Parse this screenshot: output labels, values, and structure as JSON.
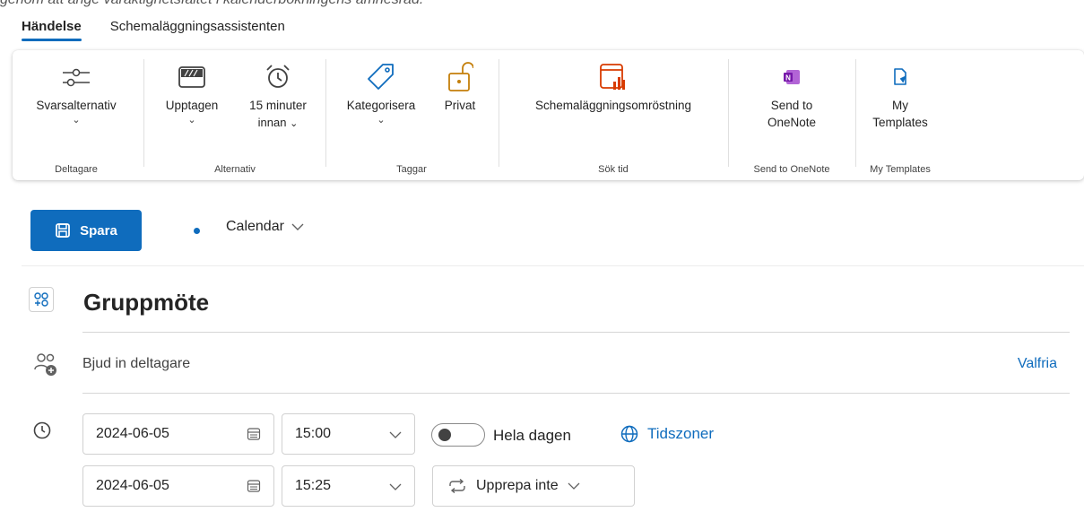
{
  "caption": "genom att ange varaktighetsfältet i kalenderbokningens ämnesrad.",
  "tabs": [
    {
      "label": "Händelse",
      "active": true
    },
    {
      "label": "Schemaläggningsassistenten",
      "active": false
    }
  ],
  "ribbon": {
    "groups": {
      "attendees": "Deltagare",
      "options": "Alternativ",
      "tags": "Taggar",
      "find_time": "Sök tid",
      "onenote": "Send to OneNote",
      "templates": "My Templates"
    },
    "buttons": {
      "response_options": "Svarsalternativ",
      "busy": "Upptagen",
      "reminder_line1": "15 minuter",
      "reminder_line2": "innan",
      "categorize": "Kategorisera",
      "private": "Privat",
      "poll": "Schemaläggningsomröstning",
      "send_onenote_line1": "Send to",
      "send_onenote_line2": "OneNote",
      "templates_line1": "My",
      "templates_line2": "Templates"
    },
    "colors": {
      "onenote": "#7719aa",
      "templates": "#0f6cbd",
      "poll": "#d83b01"
    }
  },
  "actions": {
    "save_label": "Spara",
    "calendar_label": "Calendar"
  },
  "event": {
    "title": "Gruppmöte",
    "attendees_placeholder": "Bjud in deltagare",
    "optional_label": "Valfria",
    "start_date": "2024-06-05",
    "start_time": "15:00",
    "end_date": "2024-06-05",
    "end_time": "15:25",
    "all_day_label": "Hela dagen",
    "all_day": false,
    "timezones_label": "Tidszoner",
    "repeat_label": "Upprepa inte"
  },
  "accent": "#0f6cbd"
}
